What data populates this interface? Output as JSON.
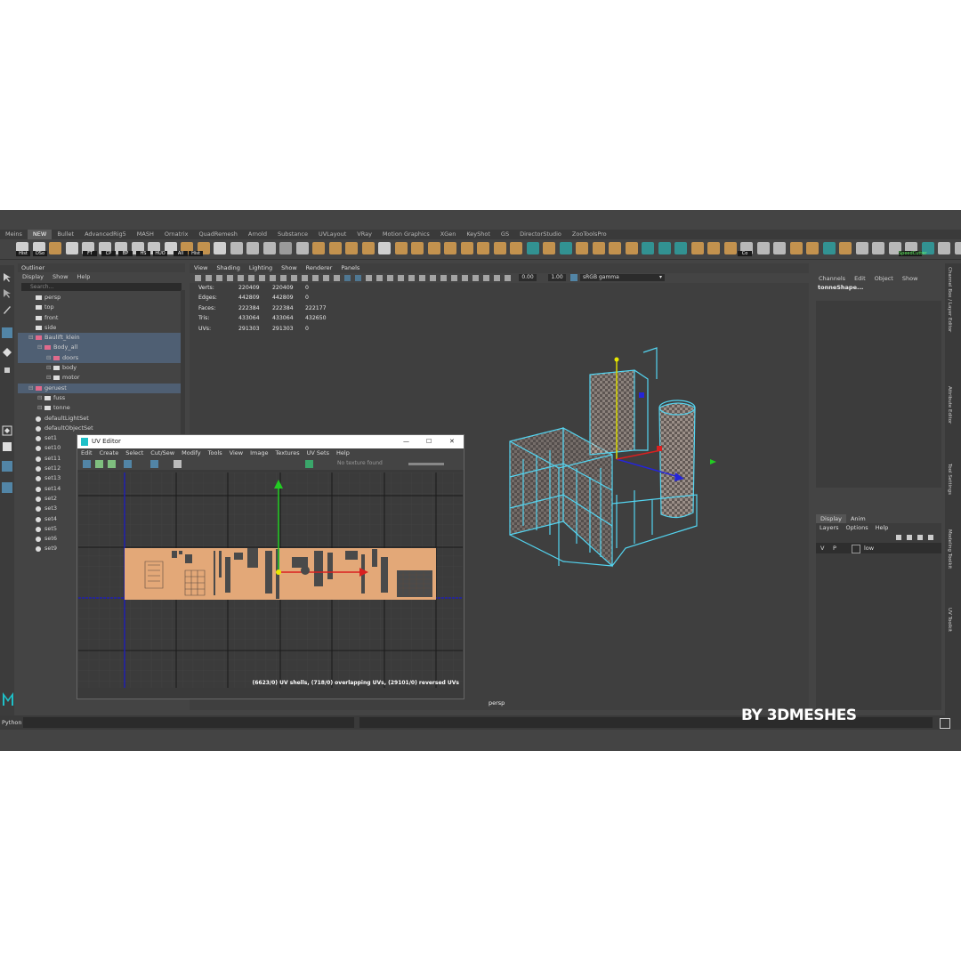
{
  "shelf_tabs": [
    "Meins",
    "NEW",
    "Bullet",
    "AdvancedRig5",
    "MASH",
    "Ornatrix",
    "QuadRemesh",
    "Arnold",
    "Substance",
    "UVLayout",
    "VRay",
    "Motion Graphics",
    "XGen",
    "KeyShot",
    "GS",
    "DirectorStudio",
    "ZooToolsPro"
  ],
  "shelf_labels": [
    "Hist",
    "DSo",
    "FT",
    "CP",
    "BP",
    "HS",
    "HUO",
    "All",
    "Hist",
    "Co",
    "SpeedCutter"
  ],
  "outliner": {
    "title": "Outliner",
    "menu": [
      "Display",
      "Show",
      "Help"
    ],
    "search_placeholder": "Search...",
    "items": [
      {
        "label": "persp",
        "indent": 0,
        "sel": false,
        "icon": "camera-icon"
      },
      {
        "label": "top",
        "indent": 0,
        "sel": false,
        "icon": "camera-icon"
      },
      {
        "label": "front",
        "indent": 0,
        "sel": false,
        "icon": "camera-icon"
      },
      {
        "label": "side",
        "indent": 0,
        "sel": false,
        "icon": "camera-icon"
      },
      {
        "label": "Baulift_klein",
        "indent": 0,
        "sel": true,
        "icon": "group-icon"
      },
      {
        "label": "Body_all",
        "indent": 1,
        "sel": true,
        "icon": "group-icon"
      },
      {
        "label": "doors",
        "indent": 2,
        "sel": true,
        "icon": "group-icon"
      },
      {
        "label": "body",
        "indent": 2,
        "sel": false,
        "icon": "mesh-icon"
      },
      {
        "label": "motor",
        "indent": 2,
        "sel": false,
        "icon": "mesh-icon"
      },
      {
        "label": "geruest",
        "indent": 0,
        "sel": true,
        "icon": "group-icon"
      },
      {
        "label": "fuss",
        "indent": 1,
        "sel": false,
        "icon": "mesh-icon"
      },
      {
        "label": "tonne",
        "indent": 1,
        "sel": false,
        "icon": "mesh-icon"
      },
      {
        "label": "defaultLightSet",
        "indent": 0,
        "sel": false,
        "icon": "set-icon"
      },
      {
        "label": "defaultObjectSet",
        "indent": 0,
        "sel": false,
        "icon": "set-icon"
      },
      {
        "label": "set1",
        "indent": 0,
        "sel": false,
        "icon": "set-icon"
      },
      {
        "label": "set10",
        "indent": 0,
        "sel": false,
        "icon": "set-icon"
      },
      {
        "label": "set11",
        "indent": 0,
        "sel": false,
        "icon": "set-icon"
      },
      {
        "label": "set12",
        "indent": 0,
        "sel": false,
        "icon": "set-icon"
      },
      {
        "label": "set13",
        "indent": 0,
        "sel": false,
        "icon": "set-icon"
      },
      {
        "label": "set14",
        "indent": 0,
        "sel": false,
        "icon": "set-icon"
      },
      {
        "label": "set2",
        "indent": 0,
        "sel": false,
        "icon": "set-icon"
      },
      {
        "label": "set3",
        "indent": 0,
        "sel": false,
        "icon": "set-icon"
      },
      {
        "label": "set4",
        "indent": 0,
        "sel": false,
        "icon": "set-icon"
      },
      {
        "label": "set5",
        "indent": 0,
        "sel": false,
        "icon": "set-icon"
      },
      {
        "label": "set6",
        "indent": 0,
        "sel": false,
        "icon": "set-icon"
      },
      {
        "label": "set9",
        "indent": 0,
        "sel": false,
        "icon": "set-icon"
      }
    ]
  },
  "viewport": {
    "menu": [
      "View",
      "Shading",
      "Lighting",
      "Show",
      "Renderer",
      "Panels"
    ],
    "field_a": "0.00",
    "field_b": "1.00",
    "colorspace": "sRGB gamma",
    "hud": [
      {
        "label": "Verts:",
        "a": "220409",
        "b": "220409",
        "c": "0"
      },
      {
        "label": "Edges:",
        "a": "442809",
        "b": "442809",
        "c": "0"
      },
      {
        "label": "Faces:",
        "a": "222384",
        "b": "222384",
        "c": "222177"
      },
      {
        "label": "Tris:",
        "a": "433064",
        "b": "433064",
        "c": "432650"
      },
      {
        "label": "UVs:",
        "a": "291303",
        "b": "291303",
        "c": "0"
      }
    ],
    "camera_label": "persp"
  },
  "uv_editor": {
    "title": "UV Editor",
    "menu": [
      "Edit",
      "Create",
      "Select",
      "Cut/Sew",
      "Modify",
      "Tools",
      "View",
      "Image",
      "Textures",
      "UV Sets",
      "Help"
    ],
    "texture_text": "No texture found",
    "status": "(6623/0) UV shells, (718/0) overlapping UVs, (29101/0) reversed UVs"
  },
  "channel_box": {
    "menu": [
      "Channels",
      "Edit",
      "Object",
      "Show"
    ],
    "node": "tonneShape...",
    "layer_tabs": [
      "Display",
      "Anim"
    ],
    "layer_menu": [
      "Layers",
      "Options",
      "Help"
    ],
    "layer_row": {
      "v": "V",
      "p": "P",
      "name": "low"
    }
  },
  "right_tabs": [
    "Channel Box / Layer Editor",
    "Attribute Editor",
    "Tool Settings",
    "Modeling Toolkit",
    "UV Toolkit"
  ],
  "bottom": {
    "python_label": "Python"
  },
  "watermark": "BY 3DMESHES",
  "colors": {
    "accent": "#5285a6",
    "selection": "#4f5f73",
    "uv_shell": "#e3a878",
    "wire": "#53d4f0"
  }
}
